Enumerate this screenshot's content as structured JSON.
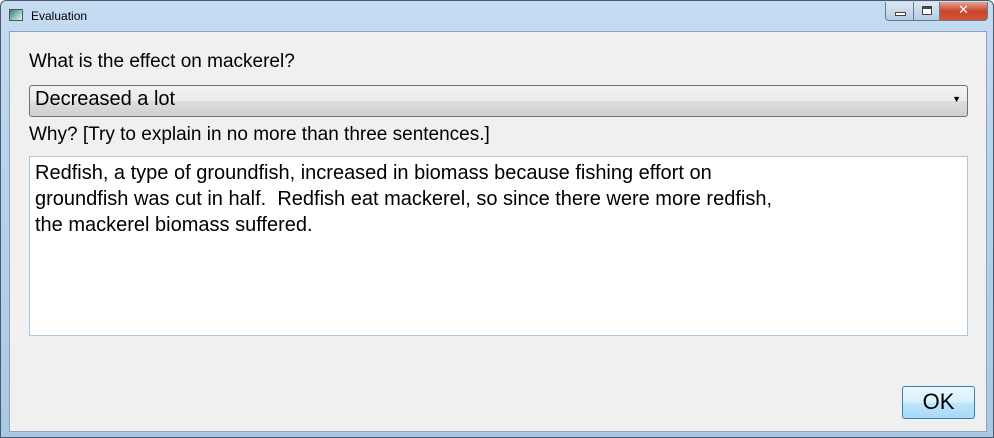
{
  "window": {
    "title": "Evaluation",
    "close_glyph": "✕"
  },
  "form": {
    "question": "What is the effect on mackerel?",
    "effect_selected": "Decreased a lot",
    "why_label": "Why? [Try to explain in no more than three sentences.]",
    "why_value": "Redfish, a type of groundfish, increased in biomass because fishing effort on\ngroundfish was cut in half.  Redfish eat mackerel, so since there were more redfish,\nthe mackerel biomass suffered.",
    "ok_label": "OK"
  }
}
